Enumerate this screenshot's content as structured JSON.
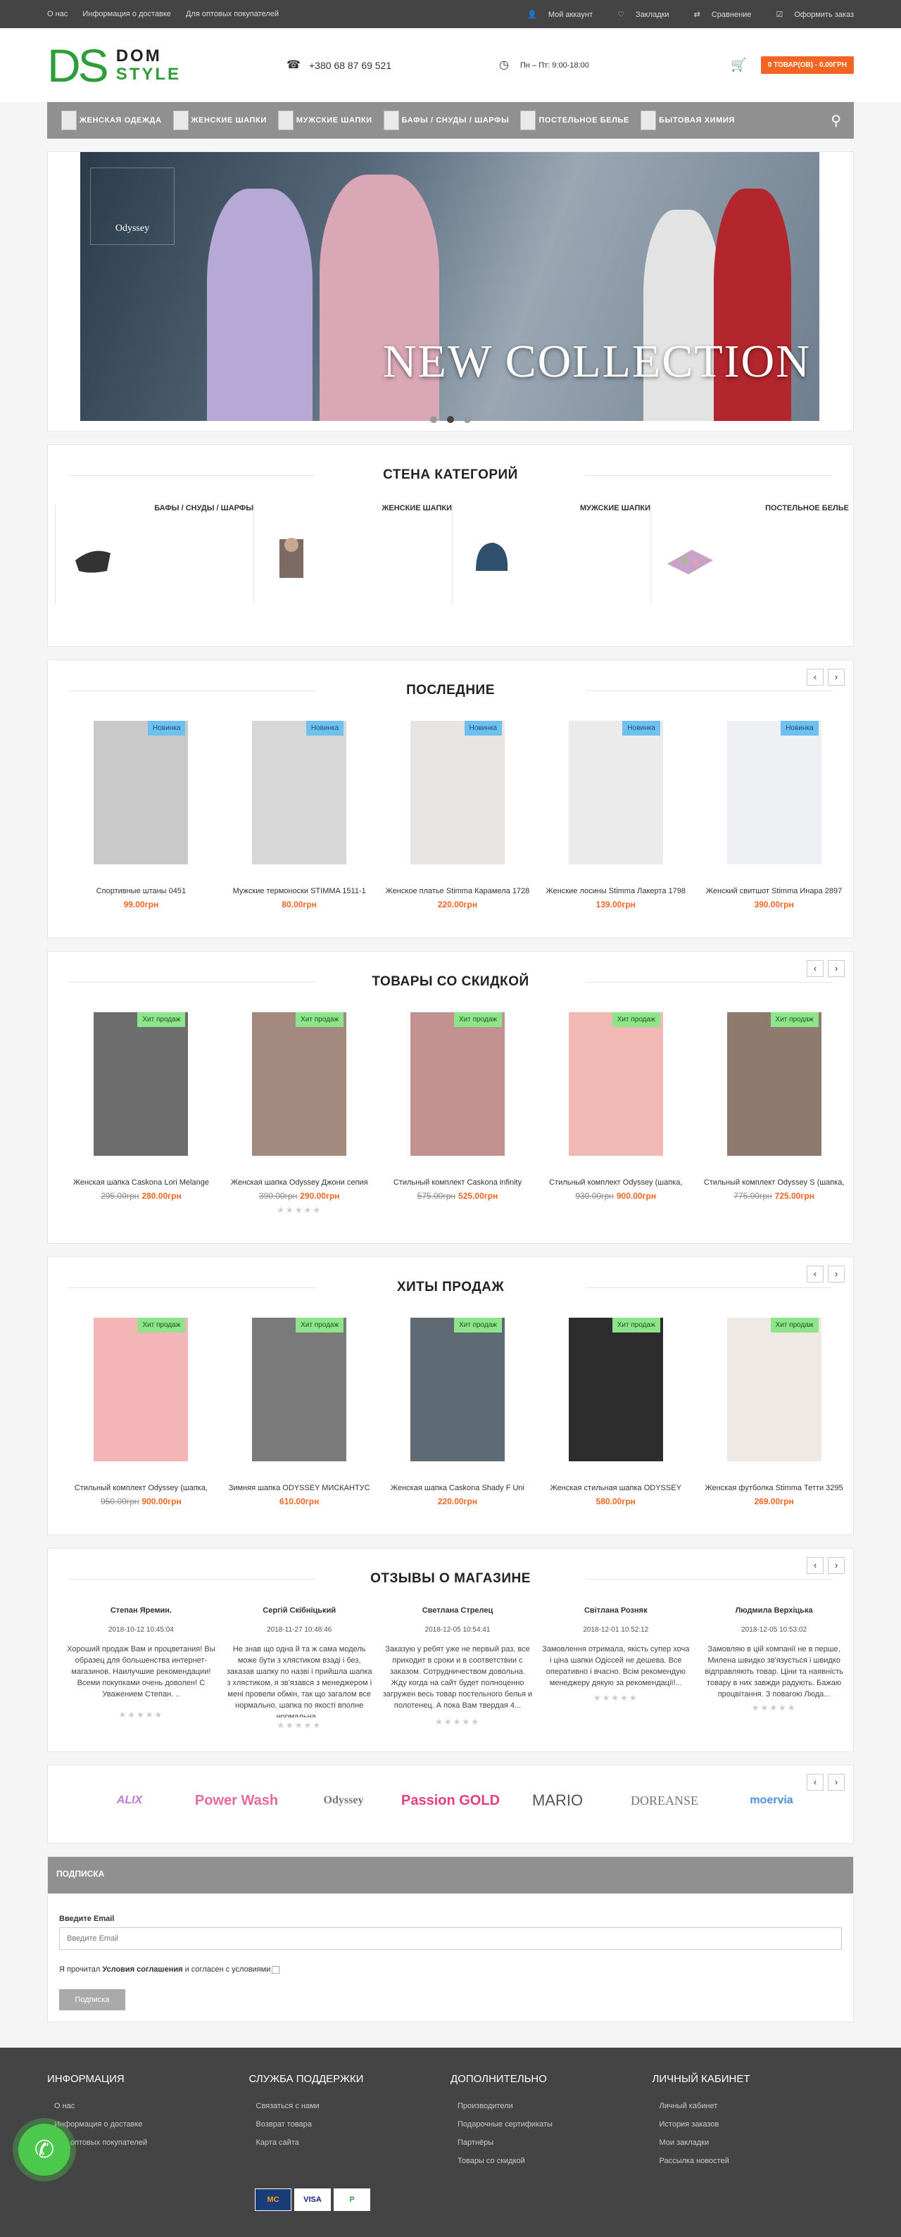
{
  "topbar": {
    "links": [
      "О нас",
      "Информация о доставке",
      "Для оптовых покупателей"
    ],
    "account": "Мой аккаунт",
    "wishlist": "Закладки",
    "compare": "Сравнение",
    "checkout": "Оформить заказ"
  },
  "header": {
    "logo_letters": "DS",
    "logo_line1": "DOM",
    "logo_line2": "STYLE",
    "phone": "+380 68 87 69 521",
    "hours": "Пн – Пт: 9:00-18:00",
    "cart": "0 ТОВАР(ОВ) - 0.00ГРН"
  },
  "nav": {
    "items": [
      "ЖЕНСКАЯ ОДЕЖДА",
      "ЖЕНСКИЕ ШАПКИ",
      "МУЖСКИЕ ШАПКИ",
      "БАФЫ / СНУДЫ / ШАРФЫ",
      "ПОСТЕЛЬНОЕ БЕЛЬЕ",
      "БЫТОВАЯ ХИМИЯ"
    ]
  },
  "slider": {
    "title": "NEW COLLECTION",
    "brand": "Odyssey",
    "active_dot": 2
  },
  "categories": {
    "title": "СТЕНА КАТЕГОРИЙ",
    "items": [
      "БАФЫ / СНУДЫ / ШАРФЫ",
      "ЖЕНСКИЕ ШАПКИ",
      "МУЖСКИЕ ШАПКИ",
      "ПОСТЕЛЬНОЕ БЕЛЬЕ"
    ]
  },
  "latest": {
    "title": "ПОСЛЕДНИЕ",
    "products": [
      {
        "name": "Спортивные штаны 0451",
        "price": "99.00грн",
        "badge": "Новинка"
      },
      {
        "name": "Мужские термоноски STIMMA 1511-1",
        "price": "80.00грн",
        "badge": "Новинка"
      },
      {
        "name": "Женское платье Stimma Карамела 1728",
        "price": "220.00грн",
        "badge": "Новинка"
      },
      {
        "name": "Женские лосины Stimma Лакерта 1798",
        "price": "139.00грн",
        "badge": "Новинка"
      },
      {
        "name": "Женский свитшот Stimma Инара 2897",
        "price": "390.00грн",
        "badge": "Новинка"
      }
    ]
  },
  "discount": {
    "title": "ТОВАРЫ СО СКИДКОЙ",
    "products": [
      {
        "name": "Женская шапка Caskona Lori Melange",
        "old": "295.00грн",
        "price": "280.00грн",
        "badge": "Хит продаж"
      },
      {
        "name": "Женская шапка Odyssey Джони сепия",
        "old": "390.00грн",
        "price": "290.00грн",
        "badge": "Хит продаж"
      },
      {
        "name": "Стильный комплект Caskona infinity",
        "old": "575.00грн",
        "price": "525.00грн",
        "badge": "Хит продаж"
      },
      {
        "name": "Стильный комплект Odyssey (шапка,",
        "old": "930.00грн",
        "price": "900.00грн",
        "badge": "Хит продаж"
      },
      {
        "name": "Стильный комплект Odyssey S (шапка,",
        "old": "775.00грн",
        "price": "725.00грн",
        "badge": "Хит продаж"
      }
    ]
  },
  "hits": {
    "title": "ХИТЫ ПРОДАЖ",
    "products": [
      {
        "name": "Стильный комплект Odyssey (шапка,",
        "old": "950.00грн",
        "price": "900.00грн",
        "badge": "Хит продаж"
      },
      {
        "name": "Зимняя шапка ODYSSEY МИСКАНТУС",
        "old": "",
        "price": "610.00грн",
        "badge": "Хит продаж"
      },
      {
        "name": "Женская шапка Caskona Shady F Uni",
        "old": "",
        "price": "220.00грн",
        "badge": "Хит продаж"
      },
      {
        "name": "Женская стильная шапка ODYSSEY",
        "old": "",
        "price": "580.00грн",
        "badge": "Хит продаж"
      },
      {
        "name": "Женская футболка Stimma Тетти 3295",
        "old": "",
        "price": "269.00грн",
        "badge": "Хит продаж"
      }
    ]
  },
  "reviews": {
    "title": "ОТЗЫВЫ О МАГАЗИНЕ",
    "items": [
      {
        "name": "Степан Яремин.",
        "date": "2018-10-12 10:45:04",
        "text": "Хороший продаж Вам и процветания! Вы образец для большенства интернет-магазинов. Наилучшие рекомендации! Всеми покупками очень доволен! С Уважением Степан. .."
      },
      {
        "name": "Сергій Скібніцький",
        "date": "2018-11-27 10:48:46",
        "text": "Не знав що одна й та ж сама модель може бути з хлястиком взаді і без, заказав шапку по назві і прийшла шапка з хлястиком, я зв'язався з менеджером і мені провели обмін, так що загалом все нормально, шапка по якості вполне нормальна..."
      },
      {
        "name": "Светлана Стрелец",
        "date": "2018-12-05 10:54:41",
        "text": "Заказую у ребят уже не первый раз, все приходит в сроки и в соответствии с заказом. Сотрудничеством довольна. Жду когда на сайт будет полноценно загружен весь товар постельного белья и полотенец. А пока Вам твердая 4..."
      },
      {
        "name": "Світлана Розняк",
        "date": "2018-12-01 10:52:12",
        "text": "Замовлення отримала, якість супер хоча і ціна шапки Одіссей не дешева. Все оперативно і вчасно. Всім рекомендую менеджеру дякую за рекомендації!..."
      },
      {
        "name": "Людмила Верхіцька",
        "date": "2018-12-05 10:53:02",
        "text": "Замовляю в цій компанії не в перше, Милена швидко зв'язується і швидко відправляють товар. Ціни та наявність товару в них завжди радують. Бажаю процвітання. З повагою Люда..."
      }
    ]
  },
  "brands": [
    "ALIX",
    "Power Wash",
    "Odyssey",
    "Passion GOLD",
    "MARIO",
    "DOREANSE",
    "moervia"
  ],
  "subscribe": {
    "head": "ПОДПИСКА",
    "label": "Введите Email",
    "placeholder": "Введите Email",
    "agree_pre": "Я прочитал",
    "agree_link": "Условия соглашения",
    "agree_post": "и согласен с условиями",
    "button": "Подписка"
  },
  "footer": {
    "col1": {
      "title": "ИНФОРМАЦИЯ",
      "links": [
        "О нас",
        "Информация о доставке",
        "Для оптовых покупателей"
      ]
    },
    "col2": {
      "title": "СЛУЖБА ПОДДЕРЖКИ",
      "links": [
        "Связаться с нами",
        "Возврат товара",
        "Карта сайта"
      ]
    },
    "col3": {
      "title": "ДОПОЛНИТЕЛЬНО",
      "links": [
        "Производители",
        "Подарочные сертификаты",
        "Партнёры",
        "Товары со скидкой"
      ]
    },
    "col4": {
      "title": "ЛИЧНЫЙ КАБИНЕТ",
      "links": [
        "Личный кабинет",
        "История заказов",
        "Мои закладки",
        "Рассылка новостей"
      ]
    },
    "pays": [
      "MC",
      "VISA",
      "P"
    ]
  },
  "colors": {
    "accent": "#f26522",
    "brand_green": "#2e9e3a",
    "new_badge": "#6ec1ef",
    "hit_badge": "#8de48a"
  }
}
